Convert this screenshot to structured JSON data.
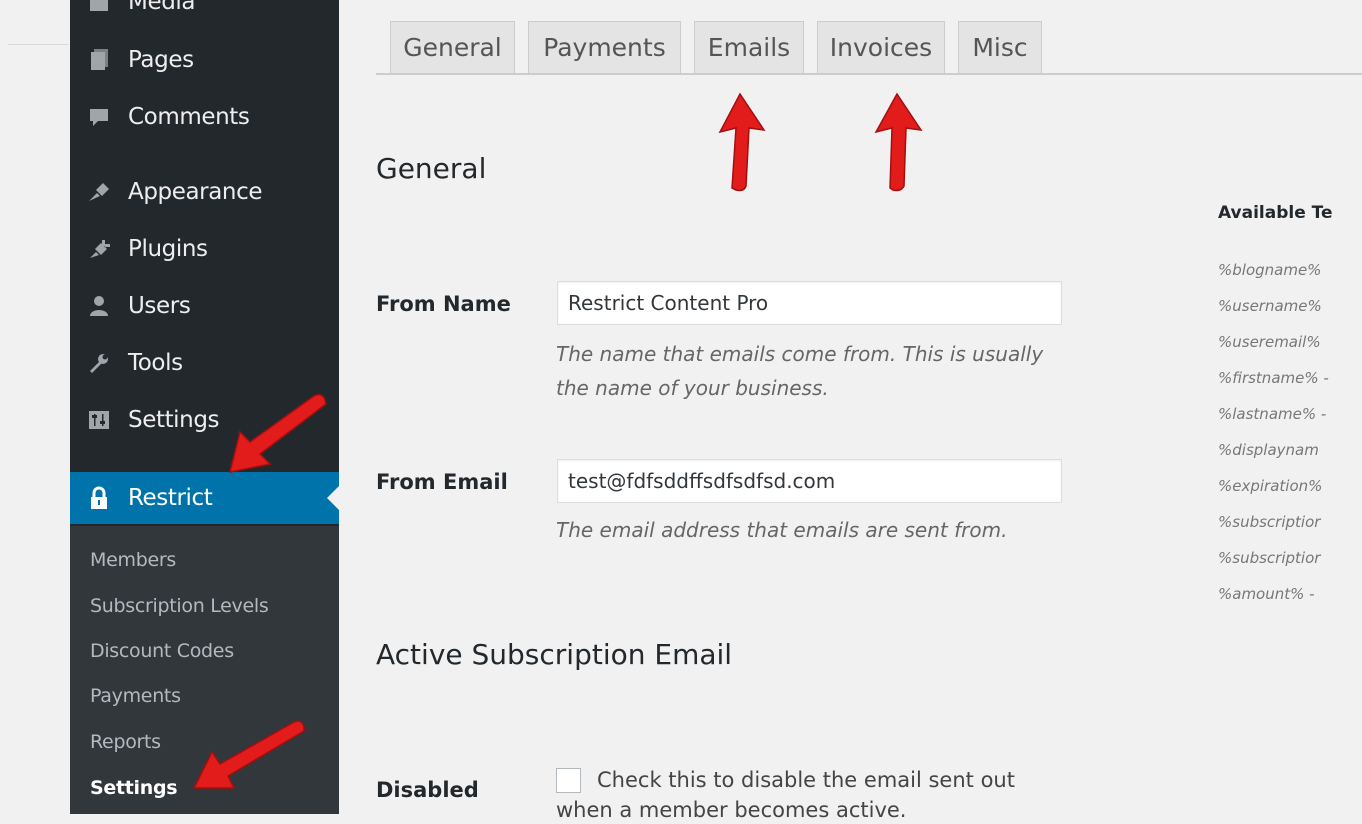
{
  "sidebar": {
    "items": [
      {
        "label": "Media",
        "icon": "media-icon"
      },
      {
        "label": "Pages",
        "icon": "pages-icon"
      },
      {
        "label": "Comments",
        "icon": "comments-icon"
      },
      {
        "label": "Appearance",
        "icon": "appearance-icon"
      },
      {
        "label": "Plugins",
        "icon": "plugins-icon"
      },
      {
        "label": "Users",
        "icon": "users-icon"
      },
      {
        "label": "Tools",
        "icon": "tools-icon"
      },
      {
        "label": "Settings",
        "icon": "settings-icon"
      },
      {
        "label": "Restrict",
        "icon": "lock-icon",
        "active": true
      }
    ],
    "submenu": [
      "Members",
      "Subscription Levels",
      "Discount Codes",
      "Payments",
      "Reports",
      "Settings"
    ],
    "current_submenu": "Settings"
  },
  "tabs": [
    "General",
    "Payments",
    "Emails",
    "Invoices",
    "Misc"
  ],
  "main": {
    "section_general": "General",
    "from_name": {
      "label": "From Name",
      "value": "Restrict Content Pro",
      "description_line1": "The name that emails come from. This is usually",
      "description_line2": "the name of your business."
    },
    "from_email": {
      "label": "From Email",
      "value": "test@fdfsddffsdfsdfsd.com",
      "description": "The email address that emails are sent from."
    },
    "section_active": "Active Subscription Email",
    "disabled": {
      "label": "Disabled",
      "text_line1": "Check this to disable the email sent out",
      "text_line2": "when a member becomes active."
    }
  },
  "template_tags": {
    "title": "Available Te",
    "items": [
      "%blogname%",
      "%username%",
      "%useremail%",
      "%firstname% -",
      "%lastname% -",
      "%displaynam",
      "%expiration%",
      "%subscriptior",
      "%subscriptior",
      "%amount% - "
    ]
  },
  "colors": {
    "sidebar_bg": "#23282d",
    "submenu_bg": "#32373c",
    "active_bg": "#0073aa",
    "annotation_arrow": "#e21b1b"
  }
}
